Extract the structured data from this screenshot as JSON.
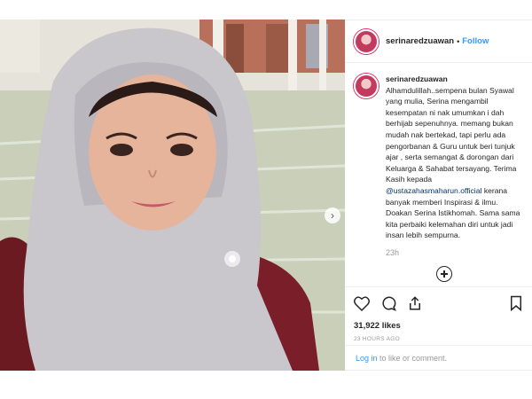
{
  "post": {
    "username": "serinaredzuawan",
    "separator": "•",
    "follow_label": "Follow",
    "caption_username": "serinaredzuawan",
    "caption_part1": "Alhamdulillah..sempena bulan Syawal yang mulia, Serina mengambil kesempatan ni nak umumkan i dah berhijab sepenuhnya. memang bukan mudah nak bertekad, tapi perlu ada pengorbanan & Guru untuk beri tunjuk ajar , serta semangat & dorongan dari Keluarga & Sahabat tersayang. Terima Kasih kepada",
    "mention": "@ustazahasmaharun.official",
    "caption_part2": "kerana banyak memberi Inspirasi & ilmu. Doakan Serina Istikhomah. Sama sama kita perbaiki kelemahan diri untuk jadi insan lebih sempurna.",
    "time_ago": "23h",
    "likes": "31,922 likes",
    "date": "23 HOURS AGO",
    "carousel_total": 5,
    "carousel_active": 1
  },
  "login": {
    "link": "Log in",
    "suffix": " to like or comment."
  },
  "icons": {
    "like": "heart-icon",
    "comment": "comment-icon",
    "share": "share-icon",
    "save": "bookmark-icon",
    "add": "plus-circle-icon",
    "next": "chevron-right-icon"
  },
  "colors": {
    "accent": "#3897f0",
    "link_dark": "#003569",
    "muted": "#999999"
  }
}
